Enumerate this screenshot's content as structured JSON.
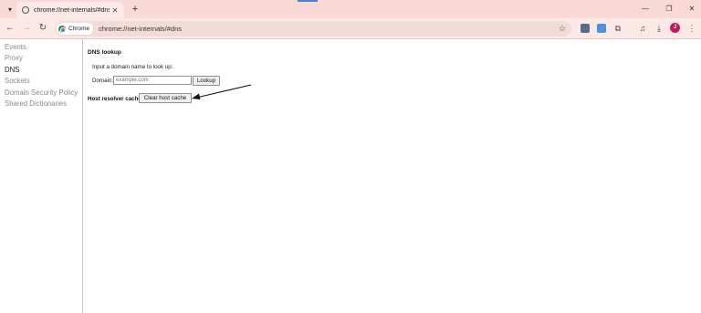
{
  "tab": {
    "title": "chrome://net-internals/#dns",
    "close": "✕",
    "new_tab": "+"
  },
  "toolbar": {
    "back": "←",
    "forward": "→",
    "reload": "↻",
    "chip_label": "Chrome",
    "url": "chrome://net-internals/#dns",
    "star": "☆",
    "download": "⤓",
    "menu": "⋮",
    "avatar_letter": "J"
  },
  "window": {
    "minimize": "—",
    "maximize": "❐",
    "close": "✕",
    "tab_menu": "▾"
  },
  "sidebar": {
    "items": [
      {
        "label": "Events"
      },
      {
        "label": "Proxy"
      },
      {
        "label": "DNS"
      },
      {
        "label": "Sockets"
      },
      {
        "label": "Domain Security Policy"
      },
      {
        "label": "Shared Dictionaries"
      }
    ]
  },
  "dns": {
    "title": "DNS lookup",
    "prompt": "Input a domain name to look up:",
    "domain_label": "Domain:",
    "domain_placeholder": "example.com",
    "lookup_button": "Lookup",
    "cache_title": "Host resolver cache",
    "clear_button": "Clear host cache"
  },
  "colors": {
    "tabstrip": "#f9d9d6",
    "toolbar": "#fbe9e7",
    "accent": "#4a7fd8",
    "avatar": "#c2185b"
  }
}
